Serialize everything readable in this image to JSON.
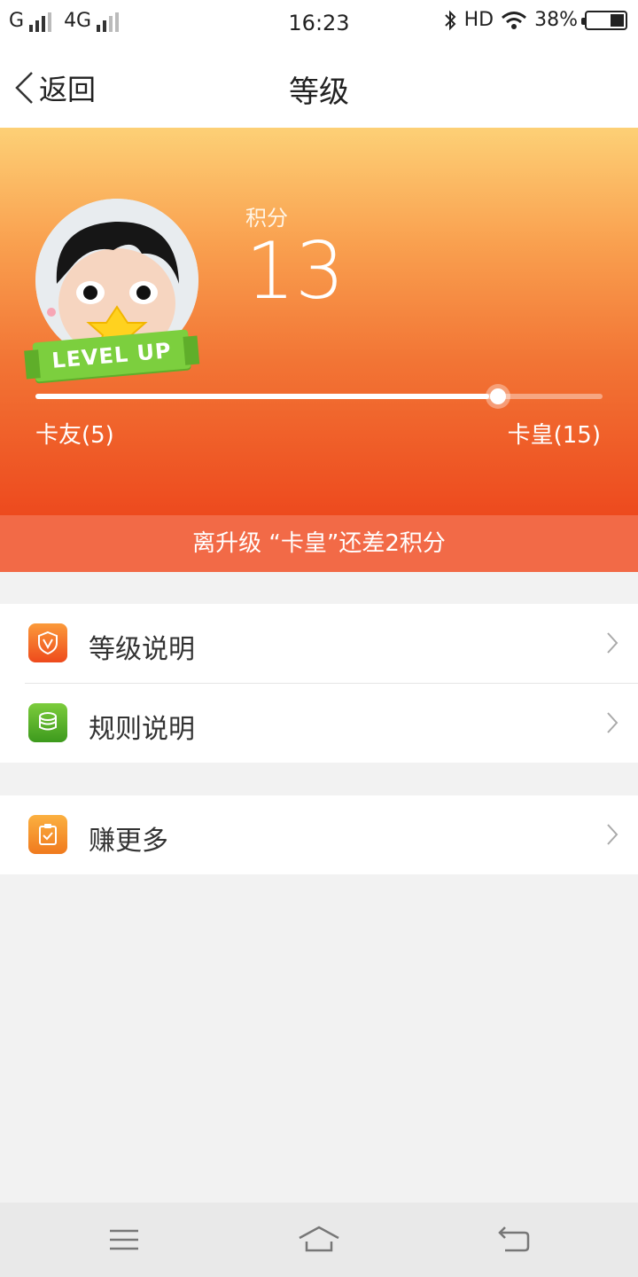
{
  "status_bar": {
    "carrier1": "G",
    "carrier2": "4G",
    "time": "16:23",
    "hd": "HD",
    "battery": "38%"
  },
  "nav": {
    "back_label": "返回",
    "title": "等级"
  },
  "hero": {
    "points_label": "积分",
    "points_value": "13",
    "badge_text": "LEVEL UP",
    "current_level": "卡友(5)",
    "next_level": "卡皇(15)",
    "progress_fraction": 0.8
  },
  "banner": {
    "text": "离升级 “卡皇”还差2积分"
  },
  "menu": {
    "items": [
      {
        "label": "等级说明",
        "icon": "shield-v-icon"
      },
      {
        "label": "规则说明",
        "icon": "coins-icon"
      },
      {
        "label": "赚更多",
        "icon": "clipboard-check-icon"
      }
    ]
  },
  "colors": {
    "header_top": "#fdd076",
    "header_bottom": "#ed4a1e",
    "banner": "#f26a47",
    "badge_green": "#7ccf3e"
  }
}
